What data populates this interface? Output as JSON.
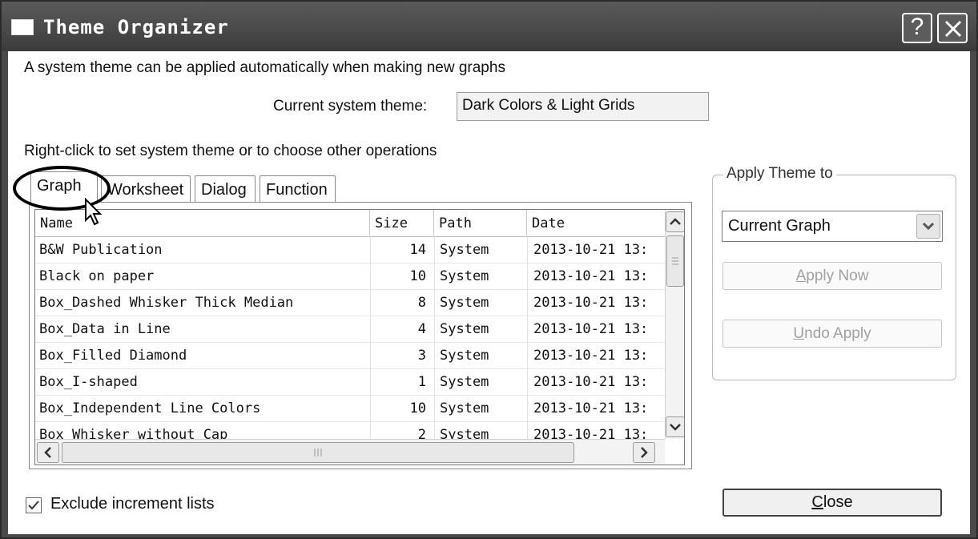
{
  "window": {
    "title": "Theme Organizer",
    "help_button": "?"
  },
  "intro_text": "A system theme can be applied automatically when making new graphs",
  "current_system_theme": {
    "label": "Current system theme:",
    "value": "Dark Colors & Light Grids"
  },
  "hint_text": "Right-click to set system theme or to choose other operations",
  "tabs": [
    {
      "label": "Graph",
      "active": true
    },
    {
      "label": "Worksheet",
      "active": false
    },
    {
      "label": "Dialog",
      "active": false
    },
    {
      "label": "Function",
      "active": false
    }
  ],
  "table": {
    "columns": [
      "Name",
      "Size",
      "Path",
      "Date"
    ],
    "rows": [
      {
        "name": "B&W Publication",
        "size": "14",
        "path": "System",
        "date": "2013-10-21 13:"
      },
      {
        "name": "Black on paper",
        "size": "10",
        "path": "System",
        "date": "2013-10-21 13:"
      },
      {
        "name": "Box_Dashed Whisker Thick Median",
        "size": "8",
        "path": "System",
        "date": "2013-10-21 13:"
      },
      {
        "name": "Box_Data in Line",
        "size": "4",
        "path": "System",
        "date": "2013-10-21 13:"
      },
      {
        "name": "Box_Filled Diamond",
        "size": "3",
        "path": "System",
        "date": "2013-10-21 13:"
      },
      {
        "name": "Box_I-shaped",
        "size": "1",
        "path": "System",
        "date": "2013-10-21 13:"
      },
      {
        "name": "Box_Independent Line Colors",
        "size": "10",
        "path": "System",
        "date": "2013-10-21 13:"
      },
      {
        "name": "Box Whisker without Cap",
        "size": "2",
        "path": "System",
        "date": "2013-10-21 13:"
      }
    ]
  },
  "apply_group": {
    "legend": "Apply Theme to",
    "target_selected": "Current Graph",
    "apply_now_prefix": "A",
    "apply_now_rest": "pply Now",
    "undo_apply_prefix": "U",
    "undo_apply_rest": "ndo Apply"
  },
  "exclude_increment": {
    "label": "Exclude increment lists",
    "checked": true
  },
  "close_button": {
    "prefix": "C",
    "rest": "lose"
  }
}
